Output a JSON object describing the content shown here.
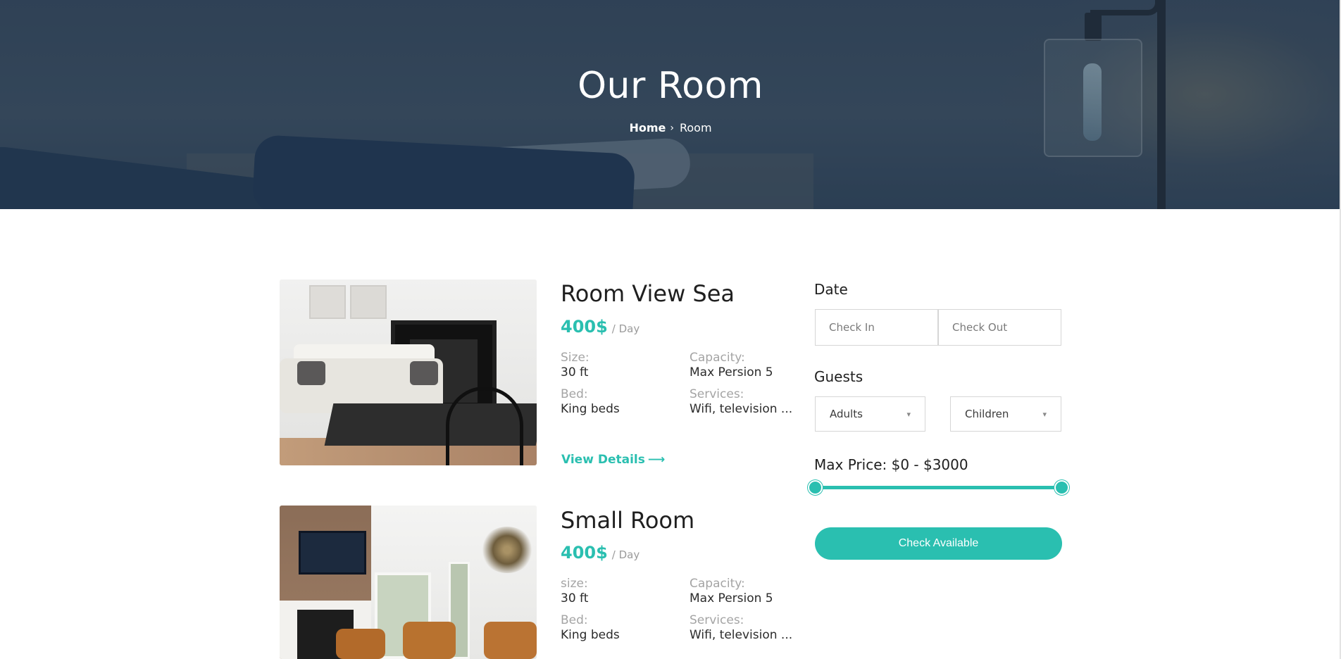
{
  "hero": {
    "title": "Our Room",
    "breadcrumb": {
      "home": "Home",
      "separator": "›",
      "current": "Room"
    }
  },
  "rooms": [
    {
      "name": "Room View Sea",
      "price": "400$",
      "price_unit": "/ Day",
      "size_label": "Size:",
      "size_value": "30 ft",
      "capacity_label": "Capacity:",
      "capacity_value": "Max Persion 5",
      "bed_label": "Bed:",
      "bed_value": "King beds",
      "services_label": "Services:",
      "services_value": "Wifi, television ...",
      "view_details": "View Details",
      "view_details_icon": "arrow-right-icon"
    },
    {
      "name": "Small Room",
      "price": "400$",
      "price_unit": "/ Day",
      "size_label": "size:",
      "size_value": "30 ft",
      "capacity_label": "Capacity:",
      "capacity_value": "Max Persion 5",
      "bed_label": "Bed:",
      "bed_value": "King beds",
      "services_label": "Services:",
      "services_value": "Wifi, television ..."
    }
  ],
  "filters": {
    "date_label": "Date",
    "check_in_placeholder": "Check In",
    "check_out_placeholder": "Check Out",
    "guests_label": "Guests",
    "adults_selected": "Adults",
    "children_selected": "Children",
    "max_price_label": "Max Price: $0 - $3000",
    "price_range": {
      "min": 0,
      "max": 3000,
      "selected_min": 0,
      "selected_max": 3000
    },
    "check_button": "Check Available"
  },
  "colors": {
    "accent": "#2abfb0",
    "hero_overlay": "#35485c",
    "text": "#1f1f1f",
    "muted": "#a4a4a4"
  }
}
